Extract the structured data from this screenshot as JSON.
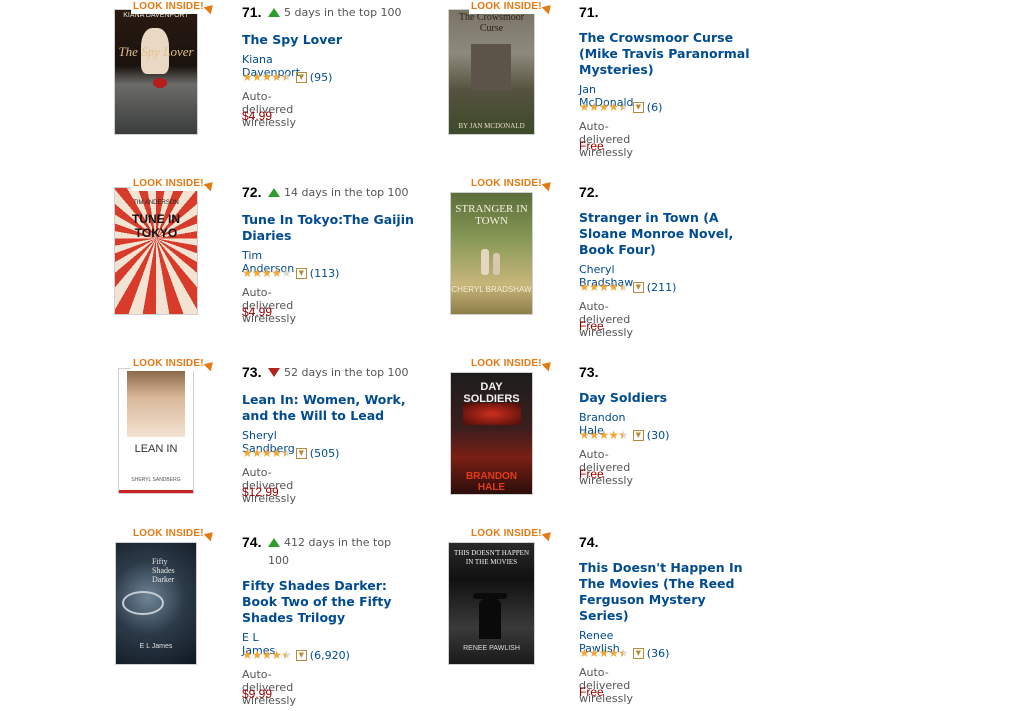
{
  "look_inside_label": "LOOK INSIDE!",
  "delivery_label": "Auto-delivered wirelessly",
  "left_column": [
    {
      "rank": "71.",
      "movement": "up",
      "days_text": "5 days in the top 100",
      "title": "The Spy Lover",
      "author": "Kiana Davenport",
      "stars": 4.5,
      "review_count": "(95)",
      "price": "$4.99",
      "cover": {
        "author": "KIANA DAVENPORT",
        "title": "The Spy Lover"
      }
    },
    {
      "rank": "72.",
      "movement": "up",
      "days_text": "14 days in the top 100",
      "title": "Tune In Tokyo:The Gaijin Diaries",
      "author": "Tim Anderson",
      "stars": 4,
      "review_count": "(113)",
      "price": "$4.99",
      "cover": {
        "author": "TIM ANDERSON",
        "title": "TUNE IN TOKYO"
      }
    },
    {
      "rank": "73.",
      "movement": "down",
      "days_text": "52 days in the top 100",
      "title": "Lean In: Women, Work, and the Will to Lead",
      "author": "Sheryl Sandberg",
      "stars": 4.5,
      "review_count": "(505)",
      "price": "$12.99",
      "cover": {
        "author": "SHERYL SANDBERG",
        "title": "LEAN IN"
      }
    },
    {
      "rank": "74.",
      "movement": "up",
      "days_text": "412 days in the top 100",
      "title": "Fifty Shades Darker: Book Two of the Fifty Shades Trilogy",
      "author": "E L James",
      "stars": 4.5,
      "review_count": "(6,920)",
      "price": "$9.99",
      "cover": {
        "author": "E L James",
        "title": "Fifty Shades Darker"
      }
    }
  ],
  "right_column": [
    {
      "rank": "71.",
      "title": "The Crowsmoor Curse (Mike Travis Paranormal Mysteries)",
      "author": "Jan McDonald",
      "stars": 4.5,
      "review_count": "(6)",
      "price": "Free",
      "cover": {
        "author": "BY JAN MCDONALD",
        "title": "The Crowsmoor Curse"
      }
    },
    {
      "rank": "72.",
      "title": "Stranger in Town (A Sloane Monroe Novel, Book Four)",
      "author": "Cheryl Bradshaw",
      "stars": 4.5,
      "review_count": "(211)",
      "price": "Free",
      "cover": {
        "author": "CHERYL BRADSHAW",
        "title": "STRANGER IN TOWN"
      }
    },
    {
      "rank": "73.",
      "title": "Day Soldiers",
      "author": "Brandon Hale",
      "stars": 4.5,
      "review_count": "(30)",
      "price": "Free",
      "cover": {
        "author": "BRANDON HALE",
        "title": "DAY SOLDIERS"
      }
    },
    {
      "rank": "74.",
      "title": "This Doesn't Happen In The Movies (The Reed Ferguson Mystery Series)",
      "author": "Renee Pawlish",
      "stars": 4.5,
      "review_count": "(36)",
      "price": "Free",
      "cover": {
        "author": "RENEE PAWLISH",
        "title": "THIS DOESN'T HAPPEN IN THE MOVIES"
      }
    }
  ],
  "colors": {
    "link": "#004b91",
    "price": "#990000",
    "look_inside": "#e47911",
    "arrow_up": "#2f9e2f",
    "arrow_down": "#b0241a",
    "star": "#f0a83a"
  }
}
